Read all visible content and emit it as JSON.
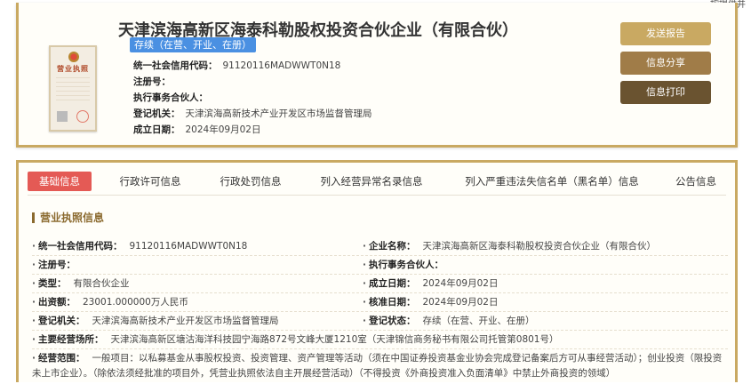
{
  "corner_text": "按提供并",
  "company": {
    "name": "天津滨海高新区海泰科勒股权投资合伙企业（有限合伙）",
    "status": "存续（在营、开业、在册）",
    "license_image_title": "营业执照",
    "fields": [
      {
        "label": "统一社会信用代码：",
        "value": "91120116MADWWT0N18"
      },
      {
        "label": "注册号：",
        "value": ""
      },
      {
        "label": "执行事务合伙人：",
        "value": ""
      },
      {
        "label": "登记机关：",
        "value": "天津滨海高新技术产业开发区市场监督管理局"
      },
      {
        "label": "成立日期：",
        "value": "2024年09月02日"
      }
    ]
  },
  "actions": {
    "send_report": "发送报告",
    "share": "信息分享",
    "print": "信息打印"
  },
  "tabs": [
    "基础信息",
    "行政许可信息",
    "行政处罚信息",
    "列入经营异常名录信息",
    "列入严重违法失信名单（黑名单）信息",
    "公告信息"
  ],
  "active_tab": "基础信息",
  "section": {
    "title": "营业执照信息",
    "rows": [
      {
        "l_label": "统一社会信用代码：",
        "l_value": "91120116MADWWT0N18",
        "r_label": "企业名称：",
        "r_value": "天津滨海高新区海泰科勒股权投资合伙企业（有限合伙）"
      },
      {
        "l_label": "注册号：",
        "l_value": "",
        "r_label": "执行事务合伙人：",
        "r_value": ""
      },
      {
        "l_label": "类型：",
        "l_value": "有限合伙企业",
        "r_label": "成立日期：",
        "r_value": "2024年09月02日"
      },
      {
        "l_label": "出资额：",
        "l_value": "23001.000000万人民币",
        "r_label": "核准日期：",
        "r_value": "2024年09月02日"
      },
      {
        "l_label": "登记机关：",
        "l_value": "天津滨海高新技术产业开发区市场监督管理局",
        "r_label": "登记状态：",
        "r_value": "存续（在营、开业、在册）"
      }
    ],
    "address": {
      "label": "主要经营场所：",
      "value": "天津滨海高新区塘沽海洋科技园宁海路872号文峰大厦1210室（天津锦信商务秘书有限公司托管第0801号）"
    },
    "scope": {
      "label": "经营范围：",
      "line1": "一般项目：以私募基金从事股权投资、投资管理、资产管理等活动（须在中国证券投资基金业协会完成登记备案后方可从事经营活动）；创业投资（限投资",
      "line2": "未上市企业）。（除依法须经批准的项目外，凭营业执照依法自主开展经营活动）（不得投资《外商投资准入负面清单》中禁止外商投资的领域）"
    }
  },
  "colors": {
    "gold": "#c9a962",
    "active_tab": "#e45a55",
    "status_badge": "#4a90e2"
  }
}
